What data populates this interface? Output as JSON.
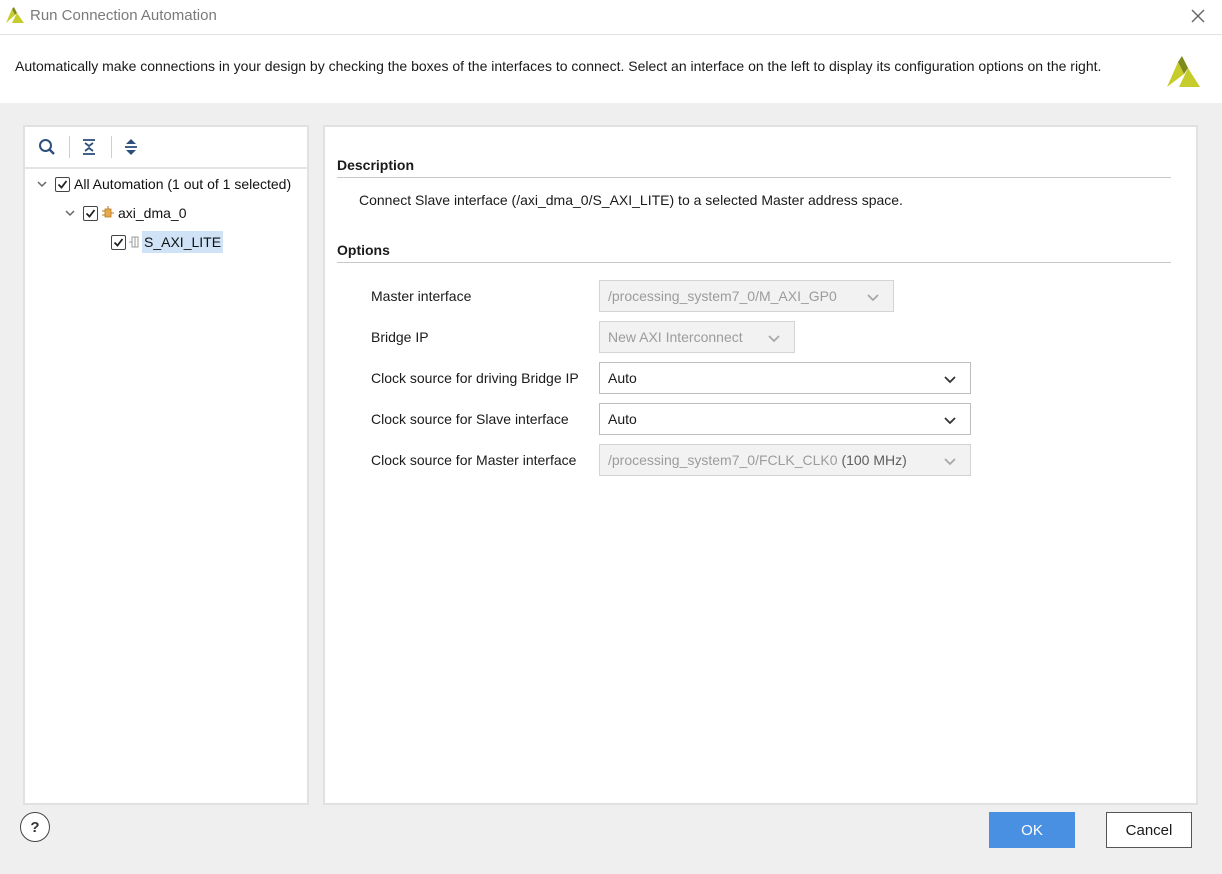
{
  "window": {
    "title": "Run Connection Automation",
    "logo_icon": "xilinx-logo-icon",
    "close_icon": "close-icon"
  },
  "banner": {
    "text": "Automatically make connections in your design by checking the boxes of the interfaces to connect. Select an interface on the left to display its configuration options on the right."
  },
  "toolbar": {
    "icons": [
      "search-icon",
      "collapse-all-icon",
      "expand-all-icon"
    ]
  },
  "tree": {
    "root": {
      "label": "All Automation (1 out of 1 selected)",
      "checked": true,
      "expanded": true
    },
    "ip": {
      "label": "axi_dma_0",
      "checked": true,
      "expanded": true,
      "icon": "ip-block-icon"
    },
    "interface": {
      "label": "S_AXI_LITE",
      "checked": true,
      "selected": true,
      "icon": "interface-port-icon"
    }
  },
  "details": {
    "description_title": "Description",
    "description_text": "Connect Slave interface (/axi_dma_0/S_AXI_LITE) to a selected Master address space.",
    "options_title": "Options",
    "options": [
      {
        "label": "Master interface",
        "value": "/processing_system7_0/M_AXI_GP0",
        "value_suffix": "",
        "enabled": false
      },
      {
        "label": "Bridge IP",
        "value": "New AXI Interconnect",
        "value_suffix": "",
        "enabled": false
      },
      {
        "label": "Clock source for driving Bridge IP",
        "value": "Auto",
        "value_suffix": "",
        "enabled": true
      },
      {
        "label": "Clock source for Slave interface",
        "value": "Auto",
        "value_suffix": "",
        "enabled": true
      },
      {
        "label": "Clock source for Master interface",
        "value": "/processing_system7_0/FCLK_CLK0",
        "value_suffix": " (100 MHz)",
        "enabled": false
      }
    ]
  },
  "footer": {
    "help_label": "?",
    "ok_label": "OK",
    "cancel_label": "Cancel"
  },
  "colors": {
    "accent": "#4a90e2",
    "selection": "#cfe2f6",
    "logo_yellow": "#c7cc2d",
    "logo_dark": "#7f8a1c"
  }
}
